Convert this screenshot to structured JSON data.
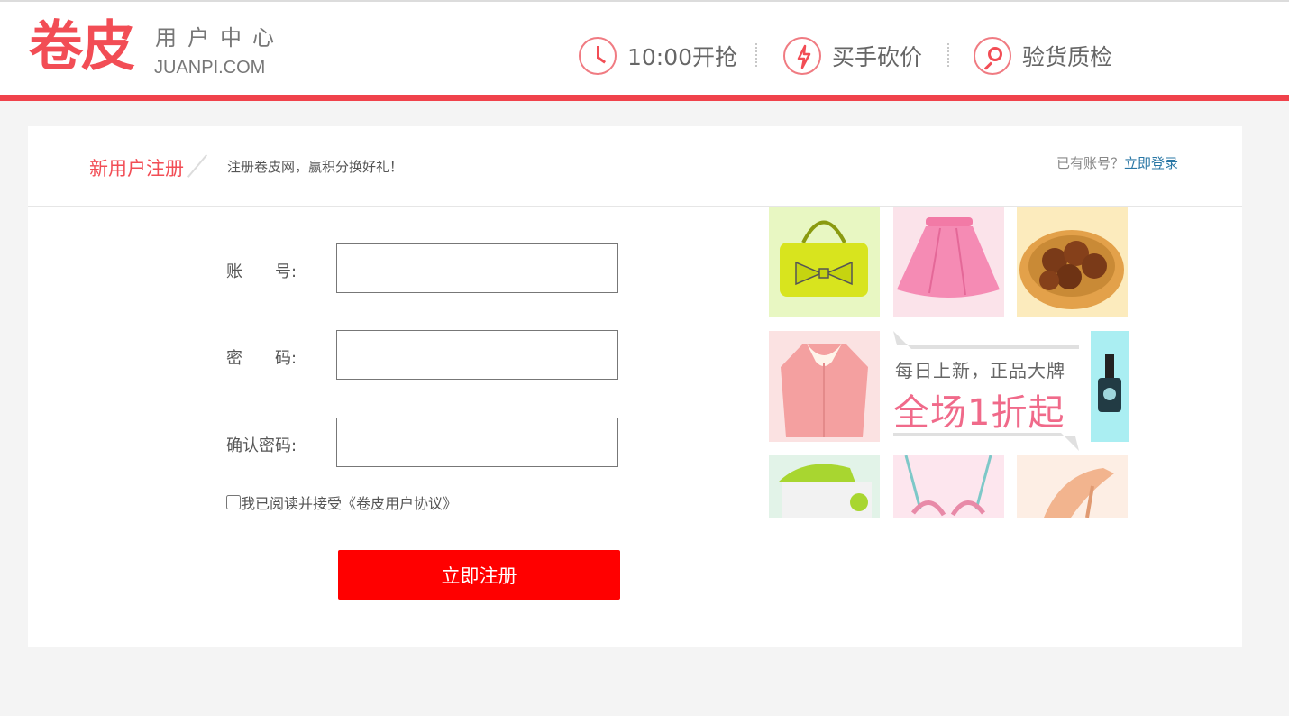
{
  "header": {
    "logo_main": "卷皮",
    "logo_sub": "用户中心",
    "logo_en": "JUANPI.COM",
    "features": [
      {
        "label": "10:00开抢",
        "icon": "clock-icon"
      },
      {
        "label": "买手砍价",
        "icon": "lightning-icon"
      },
      {
        "label": "验货质检",
        "icon": "magnifier-icon"
      }
    ]
  },
  "register": {
    "title": "新用户注册",
    "subtitle": "注册卷皮网，赢积分换好礼！",
    "have_account": "已有账号？",
    "login_link": "立即登录",
    "fields": [
      {
        "label": "账　　号:",
        "value": ""
      },
      {
        "label": "密　　码:",
        "value": ""
      },
      {
        "label": "确认密码:",
        "value": ""
      }
    ],
    "agreement": "我已阅读并接受《卷皮用户协议》",
    "submit_label": "立即注册"
  },
  "promo": {
    "line1": "每日上新，正品大牌",
    "line2": "全场1折起"
  },
  "colors": {
    "brand": "#f24d55",
    "submit": "#ff0000",
    "link": "#2a77a5"
  }
}
